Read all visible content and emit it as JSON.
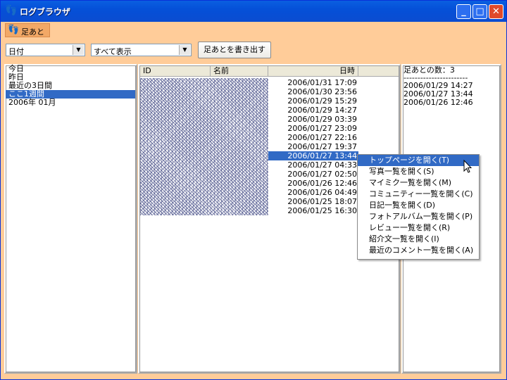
{
  "window": {
    "title": "ログブラウザ",
    "icon": "footprint-icon",
    "controls": {
      "minimize": "_",
      "maximize": "□",
      "close": "✕"
    }
  },
  "toolbar": {
    "tab_label": "足あと"
  },
  "filters": {
    "date_select_value": "日付",
    "view_select_value": "すべて表示",
    "export_button_label": "足あとを書き出す"
  },
  "date_list": [
    {
      "label": "今日",
      "selected": false
    },
    {
      "label": "昨日",
      "selected": false
    },
    {
      "label": "最近の3日間",
      "selected": false
    },
    {
      "label": "ここ1週間",
      "selected": true
    },
    {
      "label": "2006年 01月",
      "selected": false
    }
  ],
  "listview": {
    "columns": [
      "ID",
      "名前",
      "日時"
    ],
    "rows": [
      {
        "datetime": "2006/01/31 17:09",
        "selected": false
      },
      {
        "datetime": "2006/01/30 23:56",
        "selected": false
      },
      {
        "datetime": "2006/01/29 15:29",
        "selected": false
      },
      {
        "datetime": "2006/01/29 14:27",
        "selected": false
      },
      {
        "datetime": "2006/01/29 03:39",
        "selected": false
      },
      {
        "datetime": "2006/01/27 23:09",
        "selected": false
      },
      {
        "datetime": "2006/01/27 22:16",
        "selected": false
      },
      {
        "datetime": "2006/01/27 19:37",
        "selected": false
      },
      {
        "datetime": "2006/01/27 13:44",
        "selected": true
      },
      {
        "datetime": "2006/01/27 04:33",
        "selected": false
      },
      {
        "datetime": "2006/01/27 02:50",
        "selected": false
      },
      {
        "datetime": "2006/01/26 12:46",
        "selected": false
      },
      {
        "datetime": "2006/01/26 04:49",
        "selected": false
      },
      {
        "datetime": "2006/01/25 18:07",
        "selected": false
      },
      {
        "datetime": "2006/01/25 16:30",
        "selected": false
      }
    ]
  },
  "info_panel": {
    "count_label": "足あとの数：3",
    "separator": "-----------------------",
    "dates": [
      "2006/01/29 14:27",
      "2006/01/27 13:44",
      "2006/01/26 12:46"
    ]
  },
  "context_menu": {
    "items": [
      {
        "label": "トップページを開く(T)",
        "highlight": true
      },
      {
        "label": "写真一覧を開く(S)",
        "highlight": false
      },
      {
        "label": "マイミク一覧を開く(M)",
        "highlight": false
      },
      {
        "label": "コミュニティー一覧を開く(C)",
        "highlight": false
      },
      {
        "label": "日記一覧を開く(D)",
        "highlight": false
      },
      {
        "label": "フォトアルバム一覧を開く(P)",
        "highlight": false
      },
      {
        "label": "レビュー一覧を開く(R)",
        "highlight": false
      },
      {
        "label": "紹介文一覧を開く(I)",
        "highlight": false
      },
      {
        "label": "最近のコメント一覧を開く(A)",
        "highlight": false
      }
    ]
  }
}
